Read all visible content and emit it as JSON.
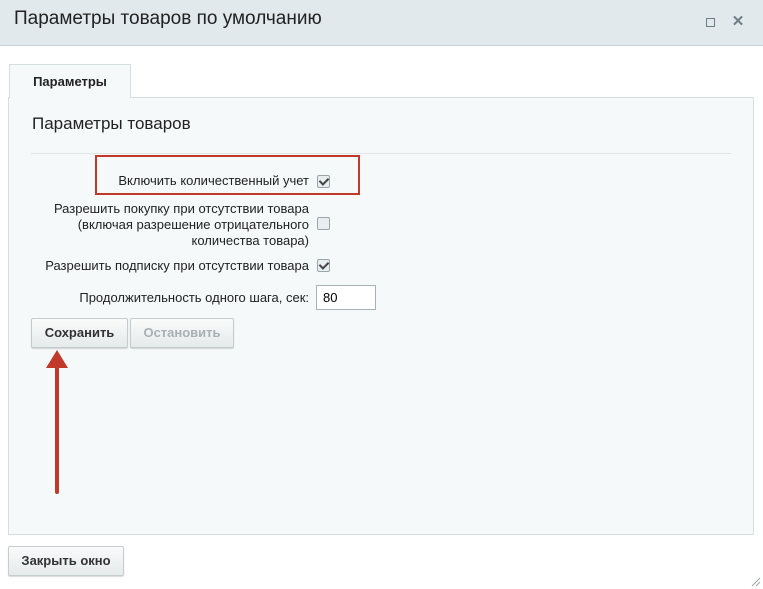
{
  "window": {
    "title": "Параметры товаров по умолчанию",
    "maximize_icon": "maximize-icon",
    "close_icon": "close-icon"
  },
  "tabs": [
    {
      "label": "Параметры",
      "active": true
    }
  ],
  "section": {
    "title": "Параметры товаров"
  },
  "fields": {
    "quantity_tracking": {
      "label": "Включить количественный учет",
      "checked": true
    },
    "allow_purchase": {
      "label_lines": [
        "Разрешить покупку при отсутствии товара",
        "(включая разрешение отрицательного",
        "количества товара)"
      ],
      "checked": false
    },
    "allow_subscribe": {
      "label": "Разрешить подписку при отсутствии товара",
      "checked": true
    },
    "step_duration": {
      "label": "Продолжительность одного шага, сек:",
      "value": "80"
    }
  },
  "buttons": {
    "save": "Сохранить",
    "stop": "Остановить",
    "close_window": "Закрыть окно"
  },
  "colors": {
    "titlebar_bg": "#e1e9ec",
    "panel_bg": "#f5f9f9",
    "annotation_red": "#c0392b"
  }
}
